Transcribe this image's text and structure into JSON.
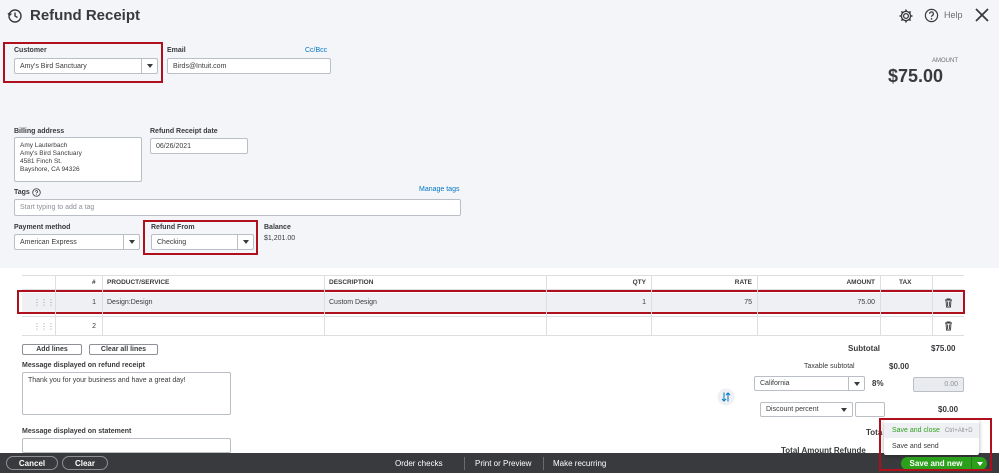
{
  "header": {
    "title": "Refund Receipt",
    "help_label": "Help"
  },
  "customer": {
    "label": "Customer",
    "value": "Amy's Bird Sanctuary"
  },
  "email": {
    "label": "Email",
    "value": "Birds@Intuit.com",
    "cc_bcc": "Cc/Bcc"
  },
  "amount": {
    "label": "AMOUNT",
    "value": "$75.00"
  },
  "billing": {
    "label": "Billing address",
    "lines": [
      "Amy Lauterbach",
      "Amy's Bird Sanctuary",
      "4581 Finch St.",
      "Bayshore, CA  94326"
    ]
  },
  "date": {
    "label": "Refund Receipt date",
    "value": "06/26/2021"
  },
  "tags": {
    "label": "Tags",
    "manage": "Manage tags",
    "placeholder": "Start typing to add a tag"
  },
  "payment": {
    "label": "Payment method",
    "value": "American Express"
  },
  "refund_from": {
    "label": "Refund From",
    "value": "Checking"
  },
  "balance": {
    "label": "Balance",
    "value": "$1,201.00"
  },
  "table": {
    "headers": {
      "num": "#",
      "product": "PRODUCT/SERVICE",
      "description": "DESCRIPTION",
      "qty": "QTY",
      "rate": "RATE",
      "amount": "AMOUNT",
      "tax": "TAX"
    },
    "rows": [
      {
        "num": "1",
        "product": "Design:Design",
        "description": "Custom Design",
        "qty": "1",
        "rate": "75",
        "amount": "75.00"
      },
      {
        "num": "2",
        "product": "",
        "description": "",
        "qty": "",
        "rate": "",
        "amount": ""
      }
    ]
  },
  "buttons": {
    "add_lines": "Add lines",
    "clear_lines": "Clear all lines"
  },
  "totals": {
    "subtotal_label": "Subtotal",
    "subtotal_value": "$75.00",
    "taxable_label": "Taxable subtotal",
    "taxable_value": "$0.00",
    "tax_region": "California",
    "tax_rate": "8%",
    "tax_value": "0.00",
    "discount_type": "Discount percent",
    "discount_value": "$0.00",
    "total_label_partial": "Tota",
    "total_amount_partial": "Total Amount Refunde"
  },
  "messages": {
    "receipt_label": "Message displayed on refund receipt",
    "receipt_value": "Thank you for your business and have a great day!",
    "statement_label": "Message displayed on statement"
  },
  "footer": {
    "cancel": "Cancel",
    "clear": "Clear",
    "order_checks": "Order checks",
    "print_preview": "Print or Preview",
    "make_recurring": "Make recurring",
    "save_new": "Save and new"
  },
  "save_menu": {
    "save_close": "Save and close",
    "save_close_shortcut": "Ctrl+Alt+D",
    "save_send": "Save and send"
  },
  "colors": {
    "accent_green": "#2ca01c",
    "highlight_red": "#b00f1c",
    "link_blue": "#0077c5"
  }
}
